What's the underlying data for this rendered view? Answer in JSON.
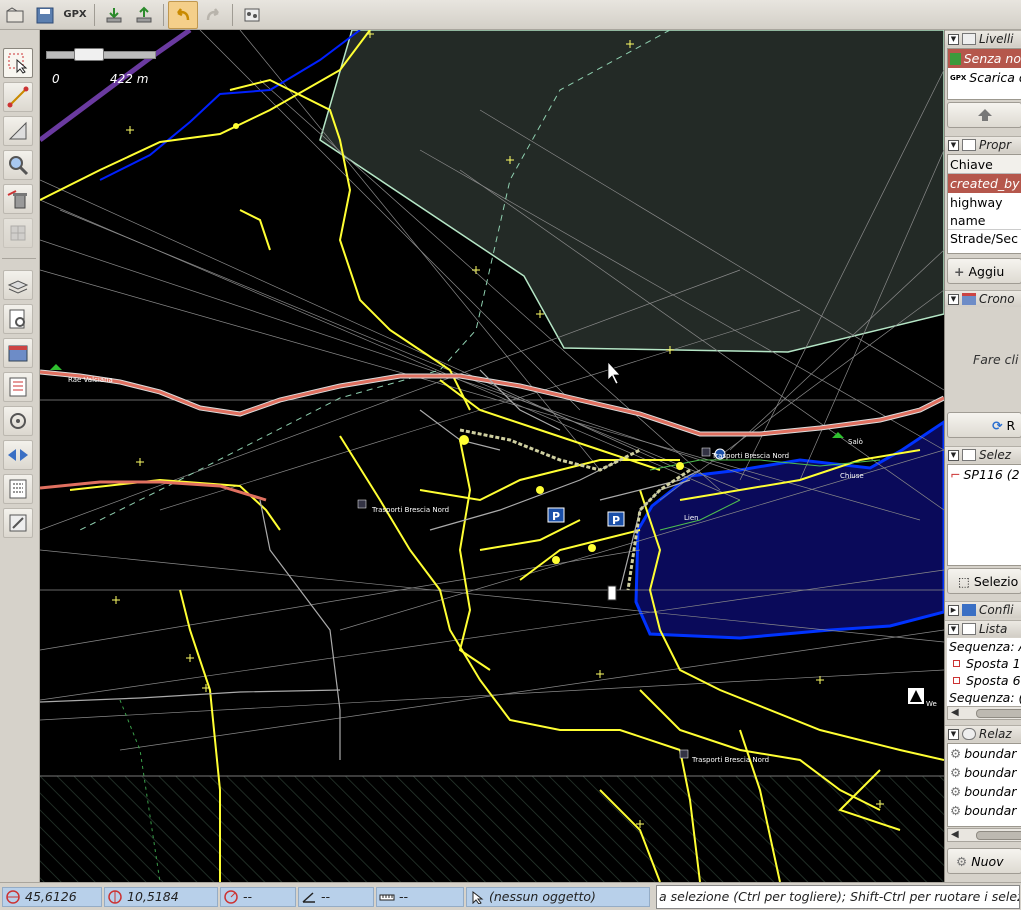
{
  "toolbar": {
    "buttons": [
      "open-icon",
      "save-icon",
      "gpx-export-icon",
      "download-icon",
      "upload-icon",
      "undo-icon",
      "redo-icon",
      "preferences-icon"
    ],
    "gpx_label": "GPX"
  },
  "map": {
    "scale": {
      "zero": "0",
      "distance": "422 m"
    },
    "labels": {
      "rae_valciana": "Rae Valciana",
      "trasporti_1": "Trasporti  Brescia Nord",
      "trasporti_2": "Trasporti  Brescia Nord",
      "trasporti_3": "Trasporti  Brescia Nord",
      "salo": "Salò",
      "lien": "Lien",
      "chiuse": "Chiuse",
      "we": "We"
    }
  },
  "panels": {
    "layers": {
      "title": "Livelli",
      "items": [
        {
          "label": "Senza no",
          "selected": true
        },
        {
          "label": "Scarica d",
          "prefix": "GPX"
        }
      ]
    },
    "properties": {
      "title": "Propr",
      "header": "Chiave",
      "rows": [
        "created_by",
        "highway",
        "name",
        "Strade/Sec"
      ],
      "add_button": "Aggiu"
    },
    "chronology": {
      "title": "Crono",
      "text": "Fare cli",
      "button": "R"
    },
    "selection": {
      "title": "Selez",
      "items": [
        "SP116 (2"
      ],
      "button": "Selezio"
    },
    "conflicts": {
      "title": "Confli"
    },
    "commands": {
      "title": "Lista",
      "items": [
        {
          "label": "Sequenza: A",
          "type": "group"
        },
        {
          "label": "Sposta 1",
          "type": "command"
        },
        {
          "label": "Sposta 6",
          "type": "command"
        },
        {
          "label": "Sequenza: (",
          "type": "group"
        }
      ]
    },
    "relations": {
      "title": "Relaz",
      "items": [
        "boundar",
        "boundar",
        "boundar",
        "boundar"
      ],
      "new_button": "Nuov"
    }
  },
  "status": {
    "lat": "45,6126",
    "lon": "10,5184",
    "heading": "--",
    "angle": "--",
    "distance": "--",
    "object": "(nessun oggetto)",
    "message": "a selezione (Ctrl per togliere); Shift-Ctrl per ruotare i selez"
  },
  "colors": {
    "map_background": "#000000",
    "road_yellow": "#ffff33",
    "primary_road": "#e07060",
    "water": "#0a0a5a",
    "water_outline": "#0033ff",
    "landuse": "#232a26",
    "selected_layer": "#b5574c",
    "status_field": "#b8d0ea"
  }
}
